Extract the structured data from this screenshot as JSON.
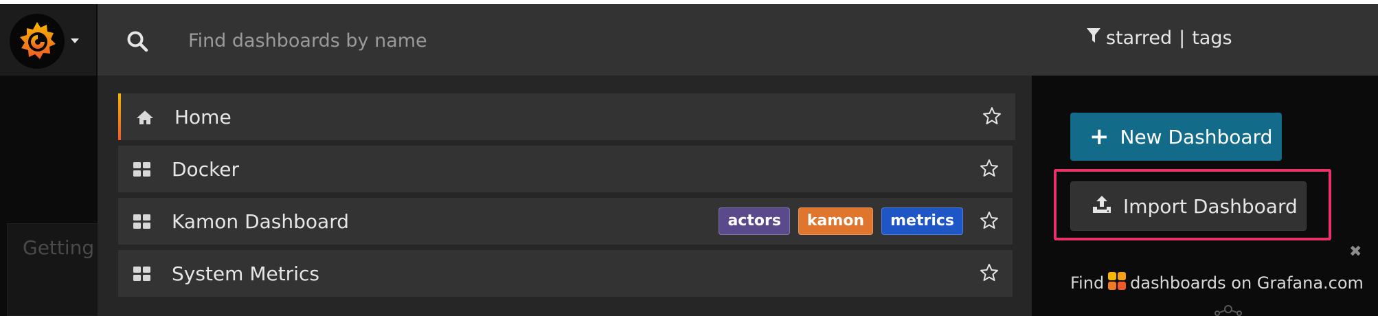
{
  "search": {
    "placeholder": "Find dashboards by name",
    "value": ""
  },
  "filters": {
    "starred_label": "starred",
    "separator": "|",
    "tags_label": "tags"
  },
  "results": [
    {
      "title": "Home",
      "icon": "home-icon",
      "tags": [],
      "starred": false
    },
    {
      "title": "Docker",
      "icon": "dashboard-grid-icon",
      "tags": [],
      "starred": false
    },
    {
      "title": "Kamon Dashboard",
      "icon": "dashboard-grid-icon",
      "tags": [
        {
          "label": "actors",
          "color": "#5a4a8c"
        },
        {
          "label": "kamon",
          "color": "#e0752d"
        },
        {
          "label": "metrics",
          "color": "#1f56c6"
        }
      ],
      "starred": false
    },
    {
      "title": "System Metrics",
      "icon": "dashboard-grid-icon",
      "tags": [],
      "starred": false
    }
  ],
  "actions": {
    "new_dashboard": "New Dashboard",
    "import_dashboard": "Import Dashboard"
  },
  "promo": {
    "prefix": "Find",
    "suffix": "dashboards on Grafana.com"
  },
  "background": {
    "card_text": "Getting S"
  },
  "colors": {
    "accent_blue": "#136b8a",
    "highlight_pink": "#e8336a",
    "grafana_orange": "#f05a28",
    "grafana_yellow": "#f7b600"
  }
}
